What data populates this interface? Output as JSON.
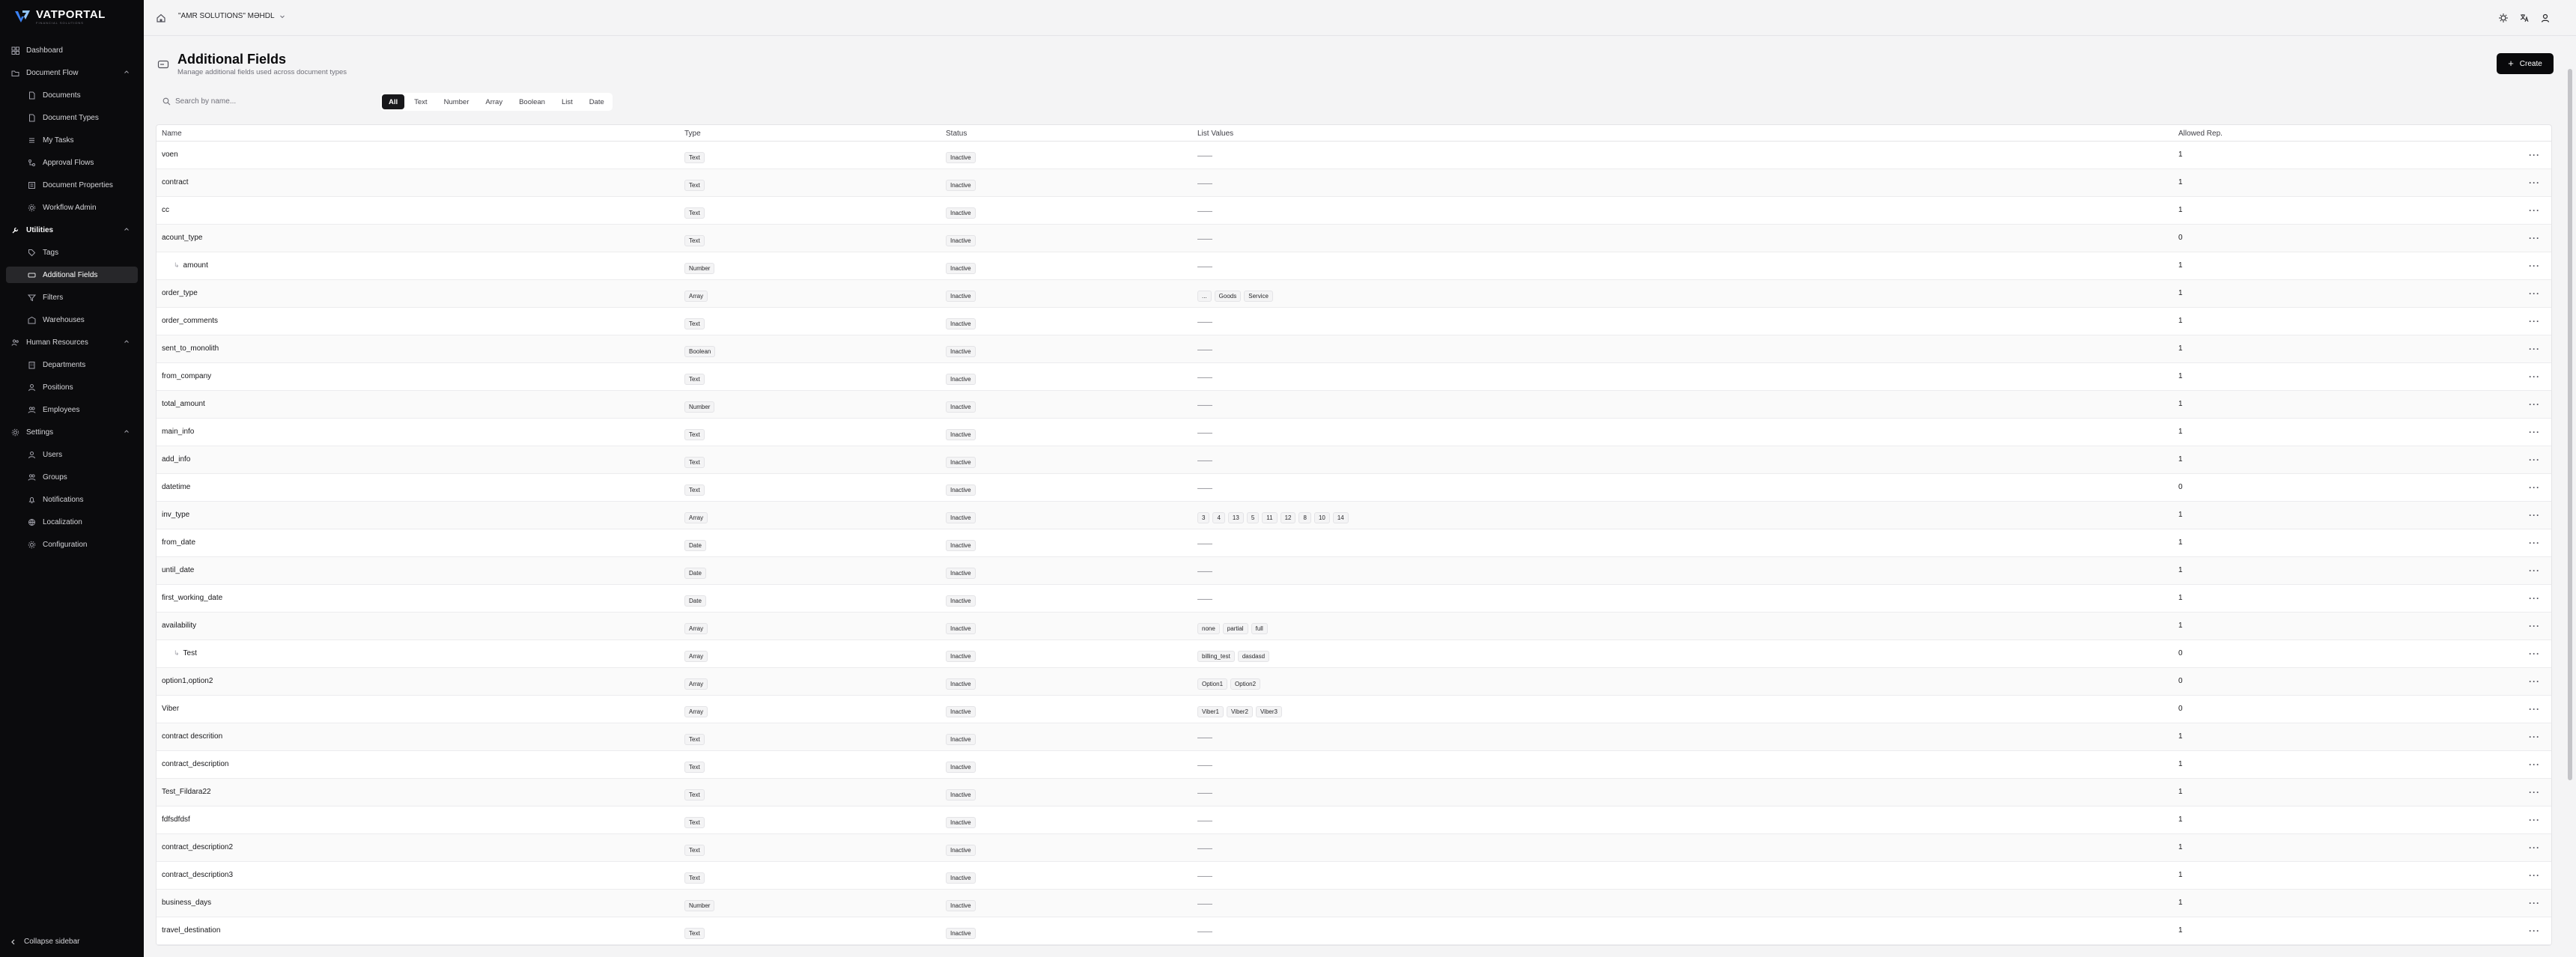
{
  "app": {
    "logo_text": "VATPORTAL",
    "logo_sub": "FINANCIAL SOLUTIONS"
  },
  "sidebar": {
    "items": [
      {
        "label": "Dashboard",
        "icon": "dashboard-icon"
      },
      {
        "label": "Document Flow",
        "icon": "folder-icon"
      },
      {
        "label": "Documents",
        "icon": "document-icon"
      },
      {
        "label": "Document Types",
        "icon": "document-icon"
      },
      {
        "label": "My Tasks",
        "icon": "tasks-icon"
      },
      {
        "label": "Approval Flows",
        "icon": "flow-icon"
      },
      {
        "label": "Document Properties",
        "icon": "properties-icon"
      },
      {
        "label": "Workflow Admin",
        "icon": "gear-icon"
      },
      {
        "label": "Utilities",
        "icon": "wrench-icon"
      },
      {
        "label": "Tags",
        "icon": "tag-icon"
      },
      {
        "label": "Additional Fields",
        "icon": "fields-icon"
      },
      {
        "label": "Filters",
        "icon": "filter-icon"
      },
      {
        "label": "Warehouses",
        "icon": "warehouse-icon"
      },
      {
        "label": "Human Resources",
        "icon": "people-icon"
      },
      {
        "label": "Departments",
        "icon": "building-icon"
      },
      {
        "label": "Positions",
        "icon": "user-icon"
      },
      {
        "label": "Employees",
        "icon": "users-icon"
      },
      {
        "label": "Settings",
        "icon": "gear-icon"
      },
      {
        "label": "Users",
        "icon": "user-icon"
      },
      {
        "label": "Groups",
        "icon": "users-icon"
      },
      {
        "label": "Notifications",
        "icon": "bell-icon"
      },
      {
        "label": "Localization",
        "icon": "globe-icon"
      },
      {
        "label": "Configuration",
        "icon": "gear-icon"
      }
    ],
    "collapse_label": "Collapse sidebar"
  },
  "topbar": {
    "company": "\"AMR SOLUTIONS\" MƏHDL"
  },
  "page": {
    "title": "Additional Fields",
    "subtitle": "Manage additional fields used across document types",
    "create_label": "Create"
  },
  "search": {
    "placeholder": "Search by name..."
  },
  "filters": [
    "All",
    "Text",
    "Number",
    "Array",
    "Boolean",
    "List",
    "Date"
  ],
  "table": {
    "headers": {
      "name": "Name",
      "type": "Type",
      "status": "Status",
      "list": "List Values",
      "allowed": "Allowed Rep."
    },
    "rows": [
      {
        "name": "voen",
        "type": "Text",
        "status": "Inactive",
        "list": [],
        "allowed": "1"
      },
      {
        "name": "contract",
        "type": "Text",
        "status": "Inactive",
        "list": [],
        "allowed": "1"
      },
      {
        "name": "cc",
        "type": "Text",
        "status": "Inactive",
        "list": [],
        "allowed": "1"
      },
      {
        "name": "acount_type",
        "type": "Text",
        "status": "Inactive",
        "list": [],
        "allowed": "0"
      },
      {
        "name": "amount",
        "type": "Number",
        "status": "Inactive",
        "list": [],
        "allowed": "1",
        "child": true
      },
      {
        "name": "order_type",
        "type": "Array",
        "status": "Inactive",
        "list": [
          "...",
          "Goods",
          "Service"
        ],
        "allowed": "1"
      },
      {
        "name": "order_comments",
        "type": "Text",
        "status": "Inactive",
        "list": [],
        "allowed": "1"
      },
      {
        "name": "sent_to_monolith",
        "type": "Boolean",
        "status": "Inactive",
        "list": [],
        "allowed": "1"
      },
      {
        "name": "from_company",
        "type": "Text",
        "status": "Inactive",
        "list": [],
        "allowed": "1"
      },
      {
        "name": "total_amount",
        "type": "Number",
        "status": "Inactive",
        "list": [],
        "allowed": "1"
      },
      {
        "name": "main_info",
        "type": "Text",
        "status": "Inactive",
        "list": [],
        "allowed": "1"
      },
      {
        "name": "add_info",
        "type": "Text",
        "status": "Inactive",
        "list": [],
        "allowed": "1"
      },
      {
        "name": "datetime",
        "type": "Text",
        "status": "Inactive",
        "list": [],
        "allowed": "0"
      },
      {
        "name": "inv_type",
        "type": "Array",
        "status": "Inactive",
        "list": [
          "3",
          "4",
          "13",
          "5",
          "11",
          "12",
          "8",
          "10",
          "14"
        ],
        "allowed": "1"
      },
      {
        "name": "from_date",
        "type": "Date",
        "status": "Inactive",
        "list": [],
        "allowed": "1"
      },
      {
        "name": "until_date",
        "type": "Date",
        "status": "Inactive",
        "list": [],
        "allowed": "1"
      },
      {
        "name": "first_working_date",
        "type": "Date",
        "status": "Inactive",
        "list": [],
        "allowed": "1"
      },
      {
        "name": "availability",
        "type": "Array",
        "status": "Inactive",
        "list": [
          "none",
          "partial",
          "full"
        ],
        "allowed": "1"
      },
      {
        "name": "Test",
        "type": "Array",
        "status": "Inactive",
        "list": [
          "billing_test",
          "dasdasd"
        ],
        "allowed": "0",
        "child": true
      },
      {
        "name": "option1,option2",
        "type": "Array",
        "status": "Inactive",
        "list": [
          "Option1",
          "Option2"
        ],
        "allowed": "0"
      },
      {
        "name": "Viber",
        "type": "Array",
        "status": "Inactive",
        "list": [
          "Viber1",
          "Viber2",
          "Viber3"
        ],
        "allowed": "0"
      },
      {
        "name": "contract descrition",
        "type": "Text",
        "status": "Inactive",
        "list": [],
        "allowed": "1"
      },
      {
        "name": "contract_description",
        "type": "Text",
        "status": "Inactive",
        "list": [],
        "allowed": "1"
      },
      {
        "name": "Test_Fildara22",
        "type": "Text",
        "status": "Inactive",
        "list": [],
        "allowed": "1"
      },
      {
        "name": "fdfsdfdsf",
        "type": "Text",
        "status": "Inactive",
        "list": [],
        "allowed": "1"
      },
      {
        "name": "contract_description2",
        "type": "Text",
        "status": "Inactive",
        "list": [],
        "allowed": "1"
      },
      {
        "name": "contract_description3",
        "type": "Text",
        "status": "Inactive",
        "list": [],
        "allowed": "1"
      },
      {
        "name": "business_days",
        "type": "Number",
        "status": "Inactive",
        "list": [],
        "allowed": "1"
      },
      {
        "name": "travel_destination",
        "type": "Text",
        "status": "Inactive",
        "list": [],
        "allowed": "1"
      }
    ]
  },
  "colors": {
    "sidebar_bg": "#0b0b0d",
    "accent": "#09090b",
    "page_bg": "#f4f4f5"
  }
}
